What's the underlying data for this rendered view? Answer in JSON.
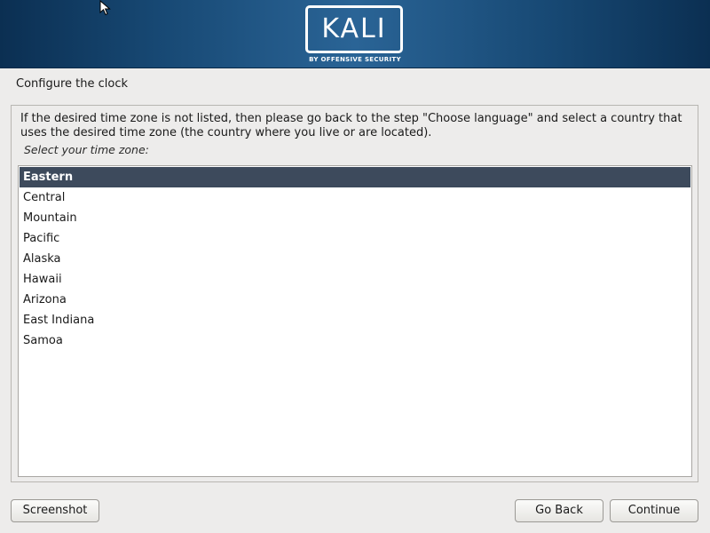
{
  "header": {
    "logo_text": "KALI",
    "logo_subtitle": "BY OFFENSIVE SECURITY"
  },
  "step": {
    "title": "Configure the clock"
  },
  "content": {
    "help_text": "If the desired time zone is not listed, then please go back to the step \"Choose language\" and select a country that uses the desired time zone (the country where you live or are located).",
    "prompt": "Select your time zone:",
    "timezones": [
      {
        "label": "Eastern",
        "selected": true
      },
      {
        "label": "Central",
        "selected": false
      },
      {
        "label": "Mountain",
        "selected": false
      },
      {
        "label": "Pacific",
        "selected": false
      },
      {
        "label": "Alaska",
        "selected": false
      },
      {
        "label": "Hawaii",
        "selected": false
      },
      {
        "label": "Arizona",
        "selected": false
      },
      {
        "label": "East Indiana",
        "selected": false
      },
      {
        "label": "Samoa",
        "selected": false
      }
    ]
  },
  "buttons": {
    "screenshot": "Screenshot",
    "go_back": "Go Back",
    "continue": "Continue"
  },
  "colors": {
    "banner": "#174873",
    "selection": "#3d4a5c",
    "background": "#edeceb"
  },
  "icons": {
    "cursor": "mouse-pointer-icon"
  }
}
